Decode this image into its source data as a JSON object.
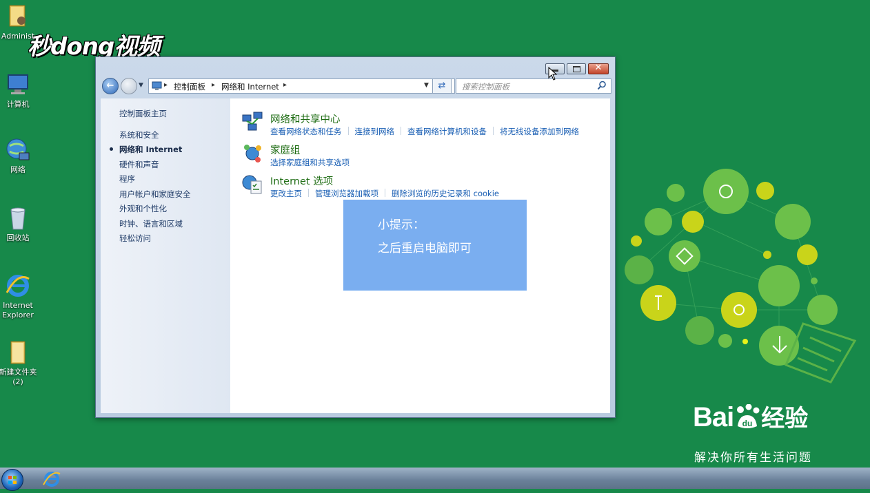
{
  "watermark": {
    "brand": "秒dong视频"
  },
  "desktop": {
    "icons": [
      {
        "label": "Administ",
        "icon": "user-folder-icon"
      },
      {
        "label": "计算机",
        "icon": "computer-icon"
      },
      {
        "label": "网络",
        "icon": "network-icon"
      },
      {
        "label": "回收站",
        "icon": "recycle-bin-icon"
      },
      {
        "label": "Internet Explorer",
        "icon": "ie-icon"
      },
      {
        "label": "新建文件夹 (2)",
        "icon": "folder-icon"
      }
    ]
  },
  "window": {
    "buttons": {
      "minimize": "—",
      "maximize": "□",
      "close": "✕"
    },
    "address": {
      "crumbs": [
        "控制面板",
        "网络和 Internet"
      ],
      "search_placeholder": "搜索控制面板"
    },
    "sidebar": {
      "home": "控制面板主页",
      "items": [
        {
          "label": "系统和安全",
          "active": false
        },
        {
          "label": "网络和 Internet",
          "active": true
        },
        {
          "label": "硬件和声音",
          "active": false
        },
        {
          "label": "程序",
          "active": false
        },
        {
          "label": "用户帐户和家庭安全",
          "active": false
        },
        {
          "label": "外观和个性化",
          "active": false
        },
        {
          "label": "时钟、语言和区域",
          "active": false
        },
        {
          "label": "轻松访问",
          "active": false
        }
      ]
    },
    "categories": [
      {
        "title": "网络和共享中心",
        "icon": "network-sharing-icon",
        "links": [
          "查看网络状态和任务",
          "连接到网络",
          "查看网络计算机和设备",
          "将无线设备添加到网络"
        ]
      },
      {
        "title": "家庭组",
        "icon": "homegroup-icon",
        "links": [
          "选择家庭组和共享选项"
        ]
      },
      {
        "title": "Internet 选项",
        "icon": "internet-options-icon",
        "links": [
          "更改主页",
          "管理浏览器加载项",
          "删除浏览的历史记录和 cookie"
        ]
      }
    ]
  },
  "tip": {
    "title": "小提示：",
    "body": "之后重启电脑即可"
  },
  "baidu": {
    "logo_left": "Bai",
    "logo_right": "经验",
    "slogan": "解决你所有生活问题"
  },
  "colors": {
    "desktop": "#17894a",
    "tip": "#7aaef0",
    "category_title": "#1f6d14",
    "link": "#1a5fb4"
  }
}
